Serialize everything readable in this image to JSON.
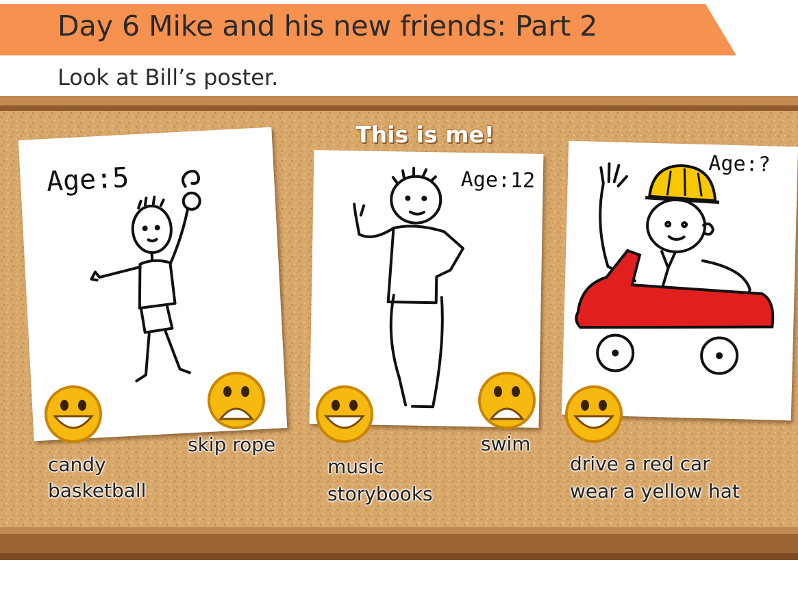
{
  "header": {
    "title": "Day 6  Mike and his new friends: Part 2",
    "instruction": "Look at Bill’s poster."
  },
  "board": {
    "title": "This is me!"
  },
  "posters": [
    {
      "age": "Age:5",
      "likes": [
        "candy",
        "basketball"
      ],
      "dislikes": [
        "skip rope"
      ]
    },
    {
      "age": "Age:12",
      "likes": [
        "music",
        "storybooks"
      ],
      "dislikes": [
        "swim"
      ]
    },
    {
      "age": "Age:?",
      "likes": [
        "drive a red car",
        "wear a yellow hat"
      ],
      "dislikes": []
    }
  ],
  "colors": {
    "banner": "#f6914f",
    "cork": "#d9a86a",
    "frame": "#b07a45",
    "smiley": "#f5b90f",
    "car": "#e21f1f",
    "hat": "#f7c800"
  },
  "icons": {
    "like": "happy-face-icon",
    "dislike": "sad-face-icon"
  }
}
